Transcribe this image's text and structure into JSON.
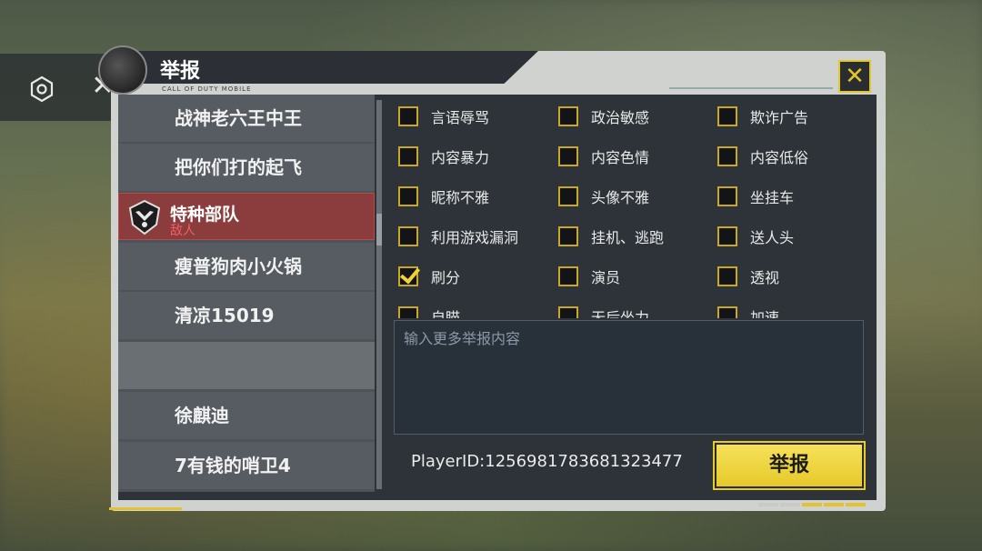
{
  "dialog": {
    "title": "举报",
    "subtitle": "CALL OF DUTY MOBILE",
    "close_icon": "close-x-icon"
  },
  "overlay": {
    "settings_icon": "hexagon-settings-icon",
    "close_icon": "close-icon"
  },
  "players": [
    {
      "name": "战神老六王中王"
    },
    {
      "name": "把你们打的起飞"
    },
    {
      "name": "特种部队",
      "tag": "敌人",
      "selected": true
    },
    {
      "name": "瘦普狗肉小火锅"
    },
    {
      "name": "清凉15019"
    },
    {
      "name": ""
    },
    {
      "name": "徐麒迪"
    },
    {
      "name": "7有钱的哨卫4"
    }
  ],
  "reasons": [
    {
      "label": "言语辱骂",
      "checked": false
    },
    {
      "label": "政治敏感",
      "checked": false
    },
    {
      "label": "欺诈广告",
      "checked": false
    },
    {
      "label": "内容暴力",
      "checked": false
    },
    {
      "label": "内容色情",
      "checked": false
    },
    {
      "label": "内容低俗",
      "checked": false
    },
    {
      "label": "昵称不雅",
      "checked": false
    },
    {
      "label": "头像不雅",
      "checked": false
    },
    {
      "label": "坐挂车",
      "checked": false
    },
    {
      "label": "利用游戏漏洞",
      "checked": false
    },
    {
      "label": "挂机、逃跑",
      "checked": false
    },
    {
      "label": "送人头",
      "checked": false
    },
    {
      "label": "刷分",
      "checked": true
    },
    {
      "label": "演员",
      "checked": false
    },
    {
      "label": "透视",
      "checked": false
    },
    {
      "label": "自瞄",
      "checked": false
    },
    {
      "label": "无后坐力",
      "checked": false
    },
    {
      "label": "加速",
      "checked": false
    }
  ],
  "details": {
    "placeholder": "输入更多举报内容"
  },
  "footer": {
    "player_id": "PlayerID:1256981783681323477",
    "report_label": "举报"
  },
  "colors": {
    "accent": "#e6c92a",
    "selected_row": "#8a3d3c",
    "enemy_tag": "#f06060"
  }
}
